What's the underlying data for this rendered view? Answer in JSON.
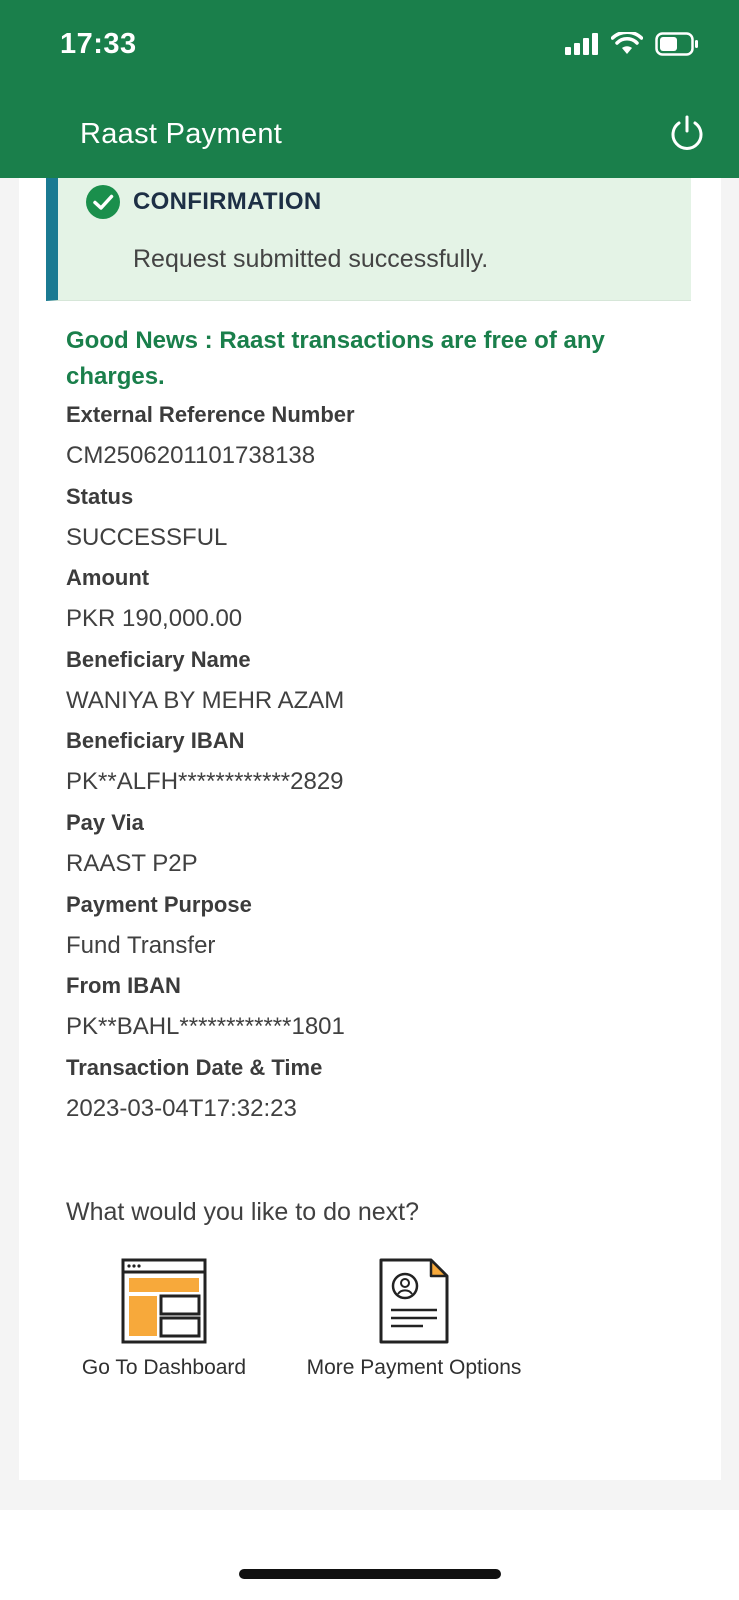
{
  "status_bar": {
    "time": "17:33"
  },
  "header": {
    "title": "Raast Payment"
  },
  "confirmation": {
    "title": "CONFIRMATION",
    "message": "Request submitted successfully."
  },
  "good_news": "Good News : Raast transactions are free of any charges.",
  "details": [
    {
      "label": "External Reference Number",
      "value": "CM2506201101738138"
    },
    {
      "label": "Status",
      "value": "SUCCESSFUL"
    },
    {
      "label": "Amount",
      "value": "PKR 190,000.00"
    },
    {
      "label": "Beneficiary Name",
      "value": "WANIYA BY MEHR AZAM"
    },
    {
      "label": "Beneficiary IBAN",
      "value": "PK**ALFH************2829"
    },
    {
      "label": "Pay Via",
      "value": "RAAST P2P"
    },
    {
      "label": "Payment Purpose",
      "value": "Fund Transfer"
    },
    {
      "label": "From IBAN",
      "value": "PK**BAHL************1801"
    },
    {
      "label": "Transaction Date & Time",
      "value": "2023-03-04T17:32:23"
    }
  ],
  "next_steps": {
    "title": "What would you like to do next?",
    "dashboard_label": "Go To Dashboard",
    "more_options_label": "More Payment Options"
  },
  "colors": {
    "header_green": "#1a7f4b",
    "accent_orange": "#f7a93b",
    "confirm_bg": "#e4f3e6",
    "confirm_border": "#1a7a92"
  }
}
